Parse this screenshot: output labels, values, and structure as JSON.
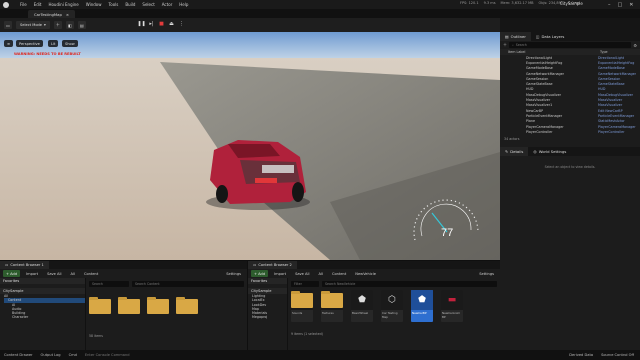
{
  "menu": {
    "items": [
      "File",
      "Edit",
      "Houdini Engine",
      "Window",
      "Tools",
      "Build",
      "Select",
      "Actor",
      "Help"
    ],
    "project": "CitySample"
  },
  "stats": [
    "FPS: 120.1",
    "9.3 ms",
    "Mem: 3,632.17 MB",
    "Objs: 234,895",
    "0.0 ms"
  ],
  "map_tab": "CarTestingMap",
  "toolbar": {
    "select_mode": "Select Mode"
  },
  "viewport": {
    "pills": [
      "Perspective",
      "Lit",
      "Show"
    ],
    "overlay_text": "WARNING: NEEDS TO BE REBUILT",
    "speed": "77"
  },
  "outliner": {
    "tab": "Outliner",
    "tab2": "Data Layers",
    "search": "Search",
    "col_label": "Item Label",
    "col_type": "Type",
    "rows": [
      {
        "name": "DirectionalLight",
        "type": "DirectionalLight"
      },
      {
        "name": "ExponentialHeightFog",
        "type": "ExponentialHeightFog"
      },
      {
        "name": "GameModeBase",
        "type": "GameModeBase"
      },
      {
        "name": "GameNetworkManager",
        "type": "GameNetworkManager"
      },
      {
        "name": "GameSession",
        "type": "GameSession"
      },
      {
        "name": "GameStateBase",
        "type": "GameStateBase"
      },
      {
        "name": "HUD",
        "type": "HUD"
      },
      {
        "name": "MassDebugVisualizer",
        "type": "MassDebugVisualizer"
      },
      {
        "name": "MassVisualizer",
        "type": "MassVisualizer"
      },
      {
        "name": "MassVisualizer1",
        "type": "MassVisualizer"
      },
      {
        "name": "NewCarBP",
        "type": "Edit NewCarBP"
      },
      {
        "name": "ParticleEventManager",
        "type": "ParticleEventManager"
      },
      {
        "name": "Plane",
        "type": "StaticMeshActor"
      },
      {
        "name": "PlayerCameraManager",
        "type": "PlayerCameraManager"
      },
      {
        "name": "PlayerController",
        "type": "PlayerController"
      }
    ],
    "count": "34 actors"
  },
  "details": {
    "tab": "Details",
    "tab2": "World Settings",
    "hint": "Select an object to view details."
  },
  "content_browser_1": {
    "tab": "Content Browser 1",
    "add": "+ Add",
    "import": "Import",
    "save_all": "Save All",
    "path": [
      "All",
      "Content"
    ],
    "settings": "Settings",
    "favorites": "Favorites",
    "project": "CitySample",
    "tree": [
      "All",
      "Content",
      "AI",
      "Audio",
      "Building",
      "Character"
    ],
    "search": "Search",
    "filter": "Search Content",
    "folders": [
      "",
      "",
      "",
      "",
      ""
    ],
    "count": "58 items",
    "collections": "Collections"
  },
  "content_browser_2": {
    "tab": "Content Browser 2",
    "add": "+ Add",
    "import": "Import",
    "save_all": "Save All",
    "path": [
      "All",
      "Content",
      "NewVehicle"
    ],
    "settings": "Settings",
    "favorites": "Favorites",
    "project": "CitySample",
    "tree": [
      "Lighting",
      "LocalEx",
      "LookDev",
      "Map",
      "Materials",
      "Megaproj"
    ],
    "search": "Search NewVehicle",
    "filter": "Filter",
    "assets": [
      {
        "name": "Sounds",
        "kind": "folder"
      },
      {
        "name": "Textures",
        "kind": "folder"
      },
      {
        "name": "BasicWheel",
        "kind": "bp"
      },
      {
        "name": "Car Testing Map",
        "kind": "map"
      },
      {
        "name": "NewCarBP",
        "kind": "selected"
      },
      {
        "name": "NewCarAnim BP",
        "kind": "car"
      }
    ],
    "count": "9 items (1 selected)",
    "collections": "Collections"
  },
  "statusbar": {
    "items": [
      "Content Drawer",
      "Output Log",
      "Cmd",
      "Enter Console Command"
    ],
    "right": [
      "Derived Data",
      "Source Control Off"
    ]
  }
}
